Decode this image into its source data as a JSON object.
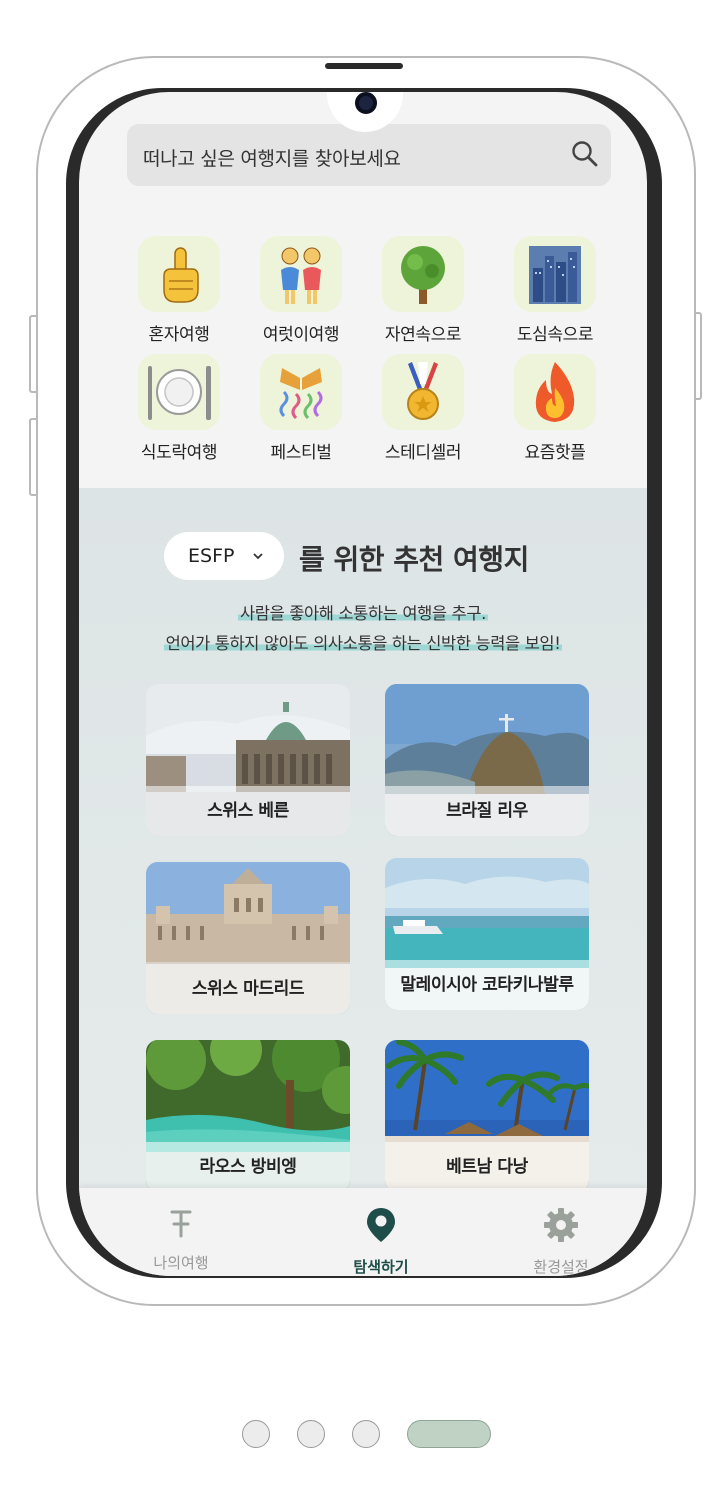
{
  "search": {
    "placeholder": "떠나고 싶은 여행지를 찾아보세요",
    "icon": "search-icon"
  },
  "categories": [
    {
      "label": "혼자여행",
      "icon": "pointing-finger-icon"
    },
    {
      "label": "여럿이여행",
      "icon": "two-girls-icon"
    },
    {
      "label": "자연속으로",
      "icon": "tree-icon"
    },
    {
      "label": "도심속으로",
      "icon": "city-icon"
    },
    {
      "label": "식도락여행",
      "icon": "plate-cutlery-icon"
    },
    {
      "label": "페스티벌",
      "icon": "confetti-icon"
    },
    {
      "label": "스테디셀러",
      "icon": "medal-icon"
    },
    {
      "label": "요즘핫플",
      "icon": "fire-icon"
    }
  ],
  "recommendation": {
    "mbti": "ESFP",
    "title": "를 위한 추천 여행지",
    "desc1": "사람을 좋아해 소통하는 여행을 추구.",
    "desc2": "언어가 통하지 않아도 의사소통을 하는 신박한 능력을 보임!"
  },
  "destinations": [
    {
      "label": "스위스 베른"
    },
    {
      "label": "브라질 리우"
    },
    {
      "label": "스위스 마드리드"
    },
    {
      "label": "말레이시아 코타키나발루"
    },
    {
      "label": "라오스 방비엥"
    },
    {
      "label": "베트남 다낭"
    }
  ],
  "nav": [
    {
      "label": "나의여행",
      "icon": "pin-board-icon"
    },
    {
      "label": "탐색하기",
      "icon": "location-pin-icon",
      "active": true
    },
    {
      "label": "환경설정",
      "icon": "gear-icon"
    }
  ],
  "pager": {
    "pages": 4,
    "current": 4
  },
  "colors": {
    "accent": "#1f4d4a",
    "highlight": "#9fd7d5",
    "categoryBg": "#eef4d9",
    "pagerActive": "#c0d2c4"
  }
}
